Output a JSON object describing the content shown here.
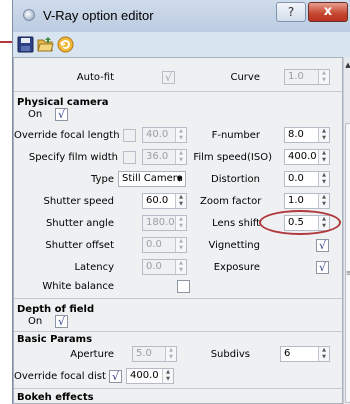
{
  "window": {
    "title": "V-Ray option editor",
    "help_label": "?",
    "close_label": "x"
  },
  "toolbar": {
    "icons": [
      "save-icon",
      "open-folder-icon",
      "refresh-icon"
    ]
  },
  "top_row": {
    "autofit_label": "Auto-fit",
    "autofit_check": "√",
    "curve_label": "Curve",
    "curve_value": "1.0"
  },
  "physical_camera": {
    "title": "Physical camera",
    "on_label": "On",
    "on_check": "√",
    "override_focal_length_label": "Override focal length",
    "focal_length_value": "40.0",
    "fnumber_label": "F-number",
    "fnumber_value": "8.0",
    "specify_film_width_label": "Specify film width",
    "film_width_value": "36.0",
    "film_speed_label": "Film speed(ISO)",
    "film_speed_value": "400.0",
    "type_label": "Type",
    "type_value": "Still Camera",
    "distortion_label": "Distortion",
    "distortion_value": "0.0",
    "shutter_speed_label": "Shutter speed",
    "shutter_speed_value": "60.0",
    "zoom_factor_label": "Zoom factor",
    "zoom_factor_value": "1.0",
    "shutter_angle_label": "Shutter angle",
    "shutter_angle_value": "180.0",
    "lens_shift_label": "Lens shift",
    "lens_shift_value": "0.5",
    "shutter_offset_label": "Shutter offset",
    "shutter_offset_value": "0.0",
    "vignetting_label": "Vignetting",
    "vignetting_check": "√",
    "latency_label": "Latency",
    "latency_value": "0.0",
    "exposure_label": "Exposure",
    "exposure_check": "√",
    "white_balance_label": "White balance"
  },
  "depth_of_field": {
    "title": "Depth of field",
    "on_label": "On",
    "on_check": "√"
  },
  "basic_params": {
    "title": "Basic Params",
    "aperture_label": "Aperture",
    "aperture_value": "5.0",
    "subdivs_label": "Subdivs",
    "subdivs_value": "6",
    "override_focal_dist_label": "Override focal dist",
    "override_focal_dist_check": "√",
    "focal_dist_value": "400.0"
  },
  "bokeh": {
    "title": "Bokeh effects"
  },
  "colors": {
    "accent_red": "#b0383c",
    "window_bg": "#d9e4f1",
    "panel_bg": "#eef0f2"
  }
}
